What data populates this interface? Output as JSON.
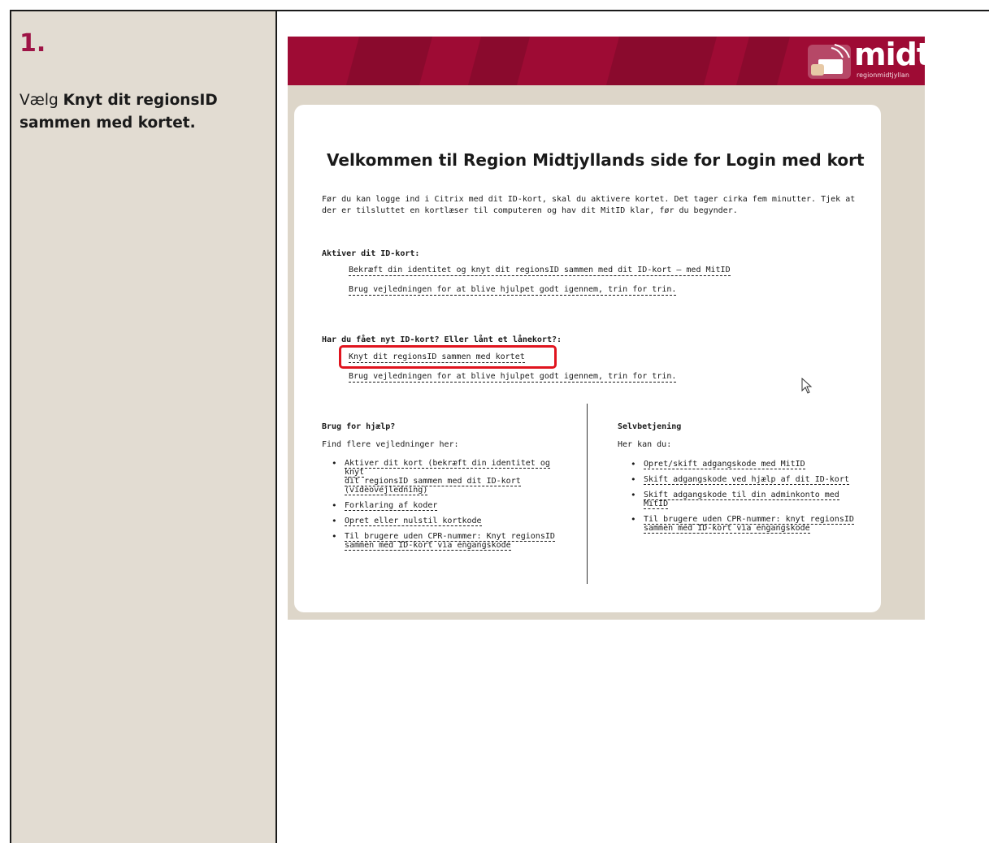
{
  "instruction": {
    "step_number": "1.",
    "prefix": "Vælg ",
    "bold_text": "Knyt dit regionsID sammen med kortet."
  },
  "header": {
    "logo_text": "midt",
    "logo_subtext": "regionmidtjyllan",
    "brand_color": "#9e0b34"
  },
  "page": {
    "title": "Velkommen til Region Midtjyllands side for Login med kort",
    "intro": "Før du kan logge ind i Citrix med dit ID-kort, skal du aktivere kortet. Det tager cirka fem minutter. Tjek at der er tilsluttet en kortlæser til computeren og hav dit MitID klar, før du begynder."
  },
  "activate": {
    "title": "Aktiver dit ID-kort:",
    "links": [
      "Bekræft din identitet og knyt dit regionsID sammen med dit ID-kort – med MitID",
      "Brug vejledningen for at blive hjulpet godt igennem, trin for trin."
    ]
  },
  "new_card": {
    "title": "Har du fået nyt ID-kort? Eller lånt et lånekort?:",
    "links": [
      "Knyt dit regionsID sammen med kortet",
      "Brug vejledningen for at blive hjulpet godt igennem, trin for trin."
    ]
  },
  "help": {
    "title": "Brug for hjælp?",
    "subtitle": "Find flere vejledninger her:",
    "items": [
      [
        "Aktiver dit kort (bekræft din identitet og knyt",
        "dit regionsID sammen med dit ID-kort",
        "(videovejledning)"
      ],
      [
        "Forklaring af koder"
      ],
      [
        "Opret eller nulstil kortkode"
      ],
      [
        "Til brugere uden CPR-nummer: Knyt regionsID",
        "sammen med ID-kort via engangskode"
      ]
    ]
  },
  "self_service": {
    "title": "Selvbetjening",
    "subtitle": "Her kan du:",
    "items": [
      [
        "Opret/skift adgangskode med MitID"
      ],
      [
        "Skift adgangskode ved hjælp af dit ID-kort"
      ],
      [
        "Skift adgangskode til din adminkonto med",
        "MitID"
      ],
      [
        "Til brugere uden CPR-nummer: knyt regionsID",
        "sammen med ID-kort via engangskode"
      ]
    ]
  },
  "highlight_color": "#e0141e"
}
